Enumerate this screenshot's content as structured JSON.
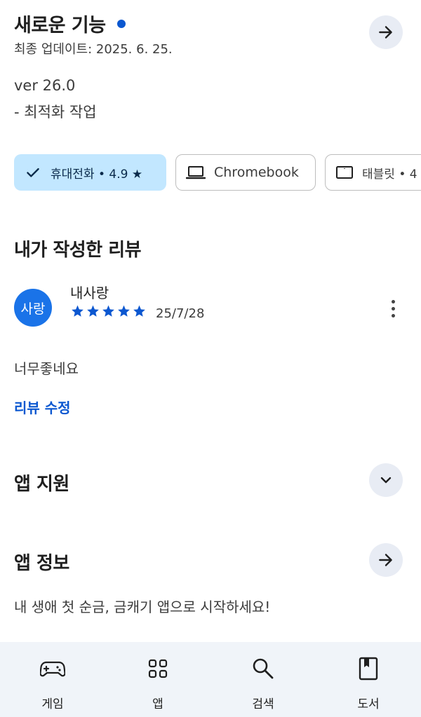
{
  "whats_new": {
    "title": "새로운 기능",
    "updated": "최종 업데이트: 2025. 6. 25.",
    "version": "ver 26.0",
    "note": "- 최적화 작업"
  },
  "device_chips": [
    {
      "label": "휴대전화 • 4.9 ★",
      "selected": true,
      "icon": "check-icon"
    },
    {
      "label": "Chromebook",
      "selected": false,
      "icon": "laptop-icon"
    },
    {
      "label": "태블릿 • 4",
      "selected": false,
      "icon": "tablet-icon"
    }
  ],
  "my_review": {
    "heading": "내가 작성한 리뷰",
    "avatar_text": "사랑",
    "reviewer": "내사랑",
    "rating": 5,
    "date": "25/7/28",
    "text": "너무좋네요",
    "edit_label": "리뷰 수정"
  },
  "app_support": {
    "heading": "앱 지원"
  },
  "app_info": {
    "heading": "앱 정보",
    "description": "내 생애 첫 순금, 금캐기 앱으로 시작하세요!"
  },
  "bottom_nav": [
    {
      "label": "게임",
      "icon": "gamepad-icon"
    },
    {
      "label": "앱",
      "icon": "apps-grid-icon"
    },
    {
      "label": "검색",
      "icon": "search-icon"
    },
    {
      "label": "도서",
      "icon": "book-icon"
    }
  ],
  "colors": {
    "accent": "#0b57d0",
    "chip_selected": "#c2e7ff",
    "star": "#0b57d0",
    "avatar": "#1a73e8",
    "nav_bg": "#f0f4f9"
  }
}
